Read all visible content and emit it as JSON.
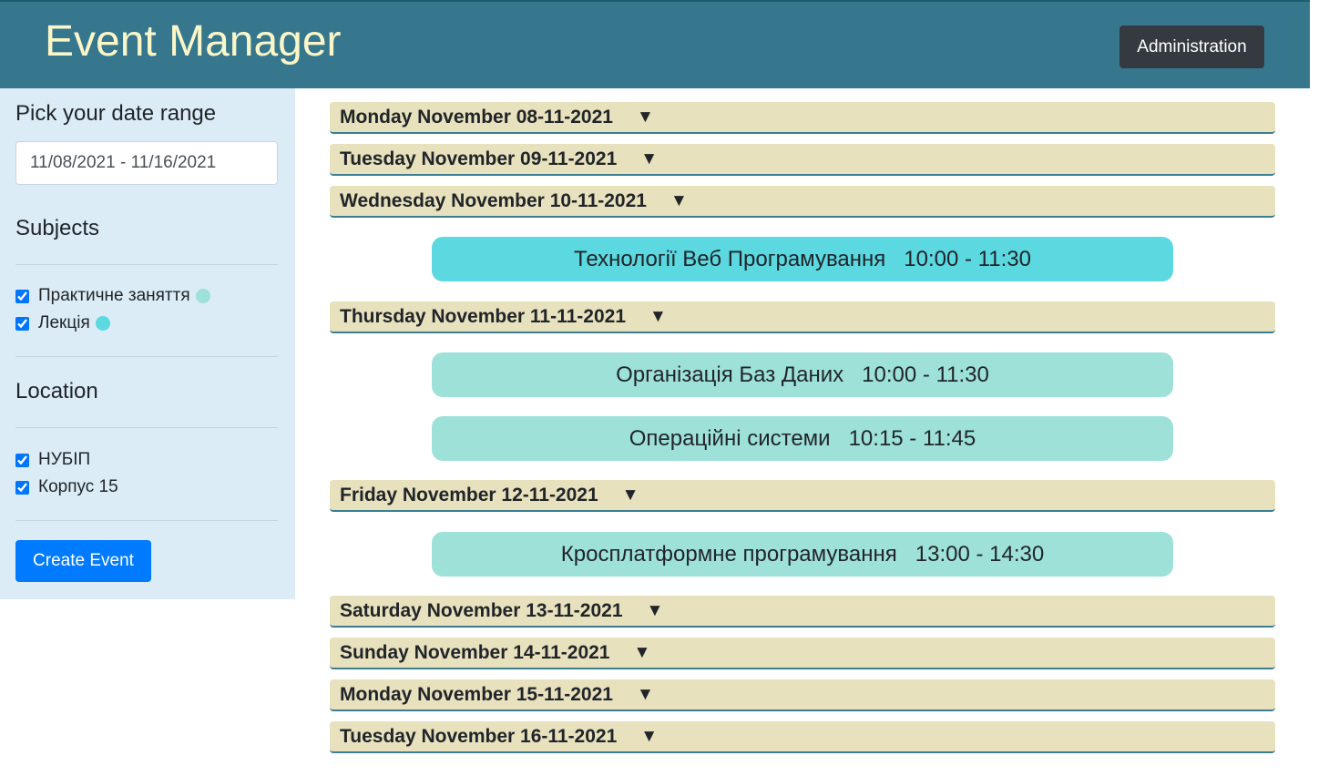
{
  "header": {
    "brand": "Event Manager",
    "admin_label": "Administration"
  },
  "sidebar": {
    "date_title": "Pick your date range",
    "date_value": "11/08/2021 - 11/16/2021",
    "subjects_title": "Subjects",
    "subjects": [
      {
        "label": "Практичне заняття",
        "color": "#9ee1d9",
        "checked": true
      },
      {
        "label": "Лекція",
        "color": "#5bd8e0",
        "checked": true
      }
    ],
    "location_title": "Location",
    "locations": [
      {
        "label": "НУБІП",
        "checked": true
      },
      {
        "label": "Корпус 15",
        "checked": true
      }
    ],
    "create_label": "Create Event"
  },
  "days": [
    {
      "label": "Monday November 08-11-2021",
      "arrow": "▼"
    },
    {
      "label": "Tuesday November 09-11-2021",
      "arrow": "▼"
    },
    {
      "label": "Wednesday November 10-11-2021",
      "arrow": "▼"
    },
    {
      "label": "Thursday November 11-11-2021",
      "arrow": "▼"
    },
    {
      "label": "Friday November 12-11-2021",
      "arrow": "▼"
    },
    {
      "label": "Saturday November 13-11-2021",
      "arrow": "▼"
    },
    {
      "label": "Sunday November 14-11-2021",
      "arrow": "▼"
    },
    {
      "label": "Monday November 15-11-2021",
      "arrow": "▼"
    },
    {
      "label": "Tuesday November 16-11-2021",
      "arrow": "▼"
    }
  ],
  "events": [
    {
      "text": "Технології Веб Програмування   10:00 - 11:30",
      "color": "#5bd8e0"
    },
    {
      "text": "Організація Баз Даних   10:00 - 11:30",
      "color": "#9ee1d9"
    },
    {
      "text": "Операційні системи   10:15 - 11:45",
      "color": "#9ee1d9"
    },
    {
      "text": "Кросплатформне програмування   13:00 - 14:30",
      "color": "#9ee1d9"
    }
  ]
}
